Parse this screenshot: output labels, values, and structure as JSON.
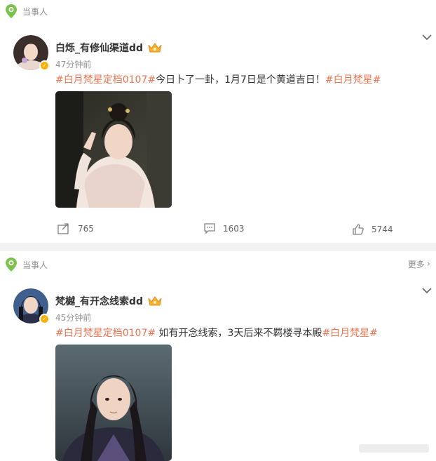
{
  "colors": {
    "accent_tag": "#eb7350",
    "location_pin": "#7bc34a",
    "verify_badge": "#f9b000",
    "meta_text": "#939393"
  },
  "posts": [
    {
      "source_label": "当事人",
      "user_name": "白烁_有修仙渠道dd",
      "time": "47分钟前",
      "text": {
        "tag1": "#白月梵星定档0107#",
        "body": "今日卜了一卦，1月7日是个黄道吉日！",
        "tag2": "#白月梵星#"
      },
      "actions": {
        "repost": "765",
        "comment": "1603",
        "like": "5744"
      },
      "icons": [
        "location-pin-icon",
        "crown-icon",
        "verified-icon",
        "repost-icon",
        "comment-icon",
        "like-icon",
        "chevron-down-icon"
      ]
    },
    {
      "source_label": "当事人",
      "more_label": "更多",
      "user_name": "梵樾_有开念线索dd",
      "time": "45分钟前",
      "text": {
        "tag1": "#白月梵星定档0107#",
        "body": " 如有开念线索，3天后来不羁楼寻本殿",
        "tag2": "#白月梵星#"
      },
      "icons": [
        "location-pin-icon",
        "crown-icon",
        "verified-icon",
        "chevron-down-icon",
        "chevron-right-icon"
      ]
    }
  ]
}
